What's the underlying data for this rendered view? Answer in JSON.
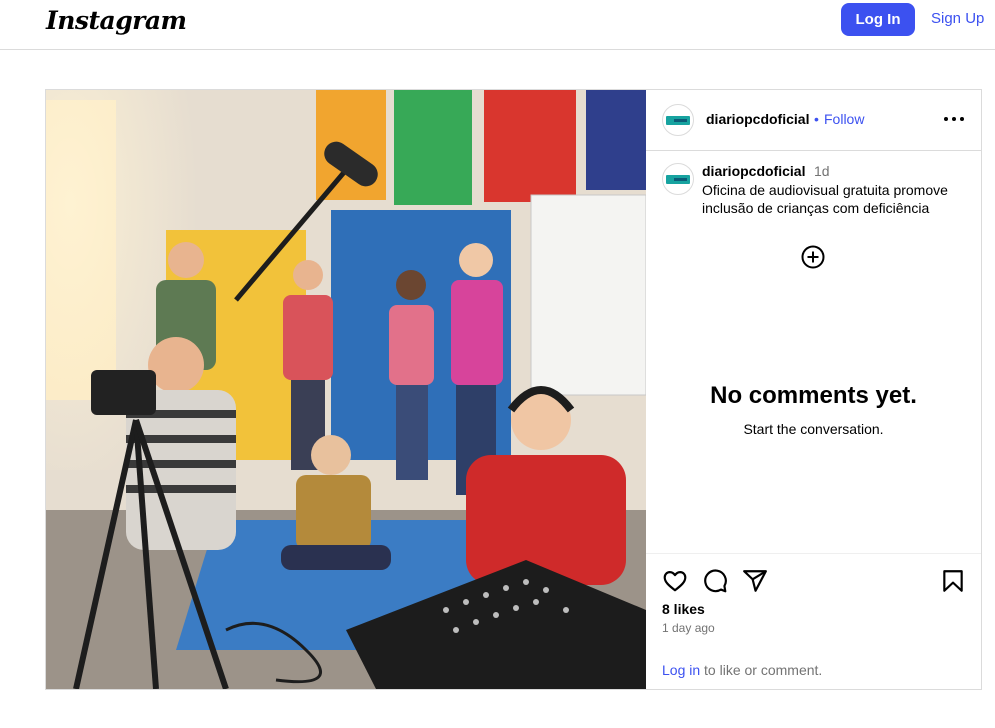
{
  "topbar": {
    "logo": "Instagram",
    "login_label": "Log In",
    "signup_label": "Sign Up"
  },
  "post": {
    "image": {
      "icon": "photo",
      "scene_colors": {
        "wall": "#e9e3d9",
        "floor": "#9b8f84",
        "rug": "#3a7fc0",
        "window": "#ffe9b8"
      }
    },
    "header": {
      "username": "diariopcdoficial",
      "separator": "•",
      "follow_label": "Follow",
      "more_icon": "ellipsis-icon"
    },
    "caption": {
      "username": "diariopcdoficial",
      "time": "1d",
      "text": "Oficina de audiovisual gratuita promove inclusão de crianças com deficiência"
    },
    "comments": {
      "add_icon": "plus-circle-icon",
      "empty_title": "No comments yet.",
      "empty_subtitle": "Start the conversation."
    },
    "actions": {
      "icons": [
        "heart-icon",
        "comment-icon",
        "share-icon",
        "bookmark-icon"
      ],
      "likes": "8 likes",
      "time_ago": "1 day ago",
      "login_link": "Log in",
      "login_suffix": " to like or comment."
    }
  },
  "colors": {
    "accent": "#3c51f0",
    "border": "#dbdbdb",
    "muted": "#737373"
  }
}
